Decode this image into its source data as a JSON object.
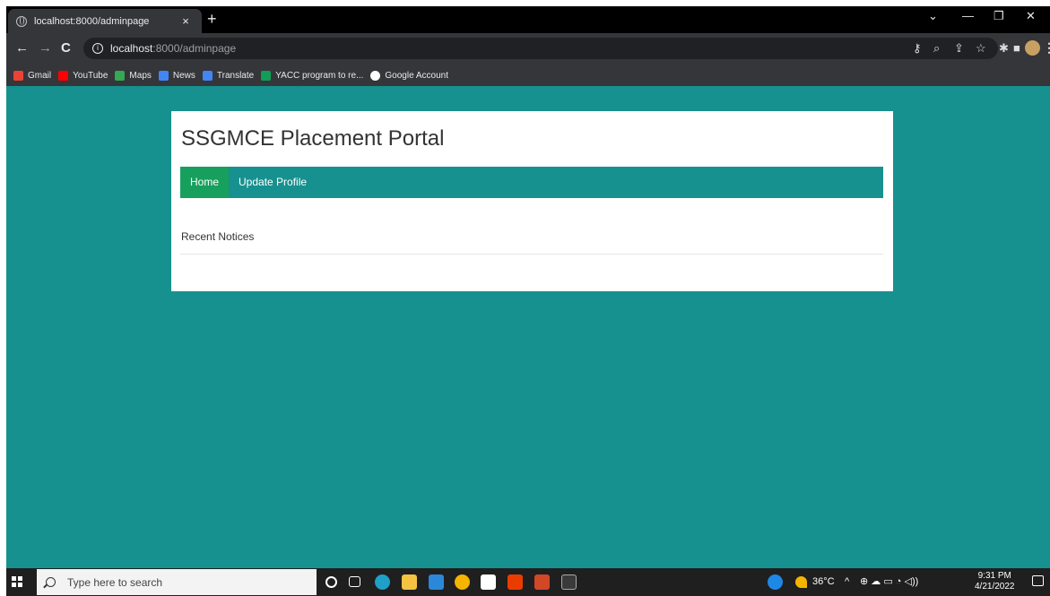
{
  "browser": {
    "tab_title": "localhost:8000/adminpage",
    "tab_close": "×",
    "new_tab": "+",
    "url_host": "localhost",
    "url_path": ":8000/adminpage",
    "bookmarks": [
      {
        "label": "Gmail",
        "color": "#ea4335"
      },
      {
        "label": "YouTube",
        "color": "#ff0000"
      },
      {
        "label": "Maps",
        "color": "#34a853"
      },
      {
        "label": "News",
        "color": "#4285f4"
      },
      {
        "label": "Translate",
        "color": "#4285f4"
      },
      {
        "label": "YACC program to re...",
        "color": "#0f9d58"
      },
      {
        "label": "Google Account",
        "color": "#ffffff"
      }
    ]
  },
  "page": {
    "site_title": "SSGMCE Placement Portal",
    "nav": [
      {
        "label": "Home",
        "active": true
      },
      {
        "label": "Update Profile",
        "active": false
      }
    ],
    "section_heading": "Recent Notices"
  },
  "taskbar": {
    "search_placeholder": "Type here to search",
    "temperature": "36°C",
    "time": "9:31 PM",
    "date": "4/21/2022"
  },
  "colors": {
    "page_bg": "#16918f",
    "navbar_bg": "#16918f",
    "nav_active": "#17a05d"
  }
}
